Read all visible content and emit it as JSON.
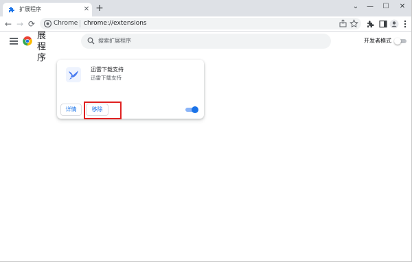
{
  "browser": {
    "tab": {
      "title": "扩展程序",
      "favicon": "puzzle-icon"
    },
    "new_tab_label": "+",
    "window_controls": {
      "minimize": "—",
      "maximize": "☐",
      "close": "✕",
      "dropdown": "⌄"
    },
    "nav": {
      "back": "←",
      "forward": "→",
      "reload": "⟳"
    },
    "omnibox": {
      "site_name": "Chrome",
      "url": "chrome://extensions"
    }
  },
  "extensions_page": {
    "title": "展程序",
    "search_placeholder": "搜索扩展程序",
    "developer_mode_label": "开发者模式",
    "developer_mode_on": false
  },
  "extension_card": {
    "name": "迅雷下载支持",
    "description": "迅雷下载支持",
    "details_label": "详情",
    "remove_label": "移除",
    "enabled": true
  },
  "colors": {
    "accent": "#1a73e8",
    "highlight_box": "#e02020",
    "tabstrip": "#dee1e6"
  }
}
